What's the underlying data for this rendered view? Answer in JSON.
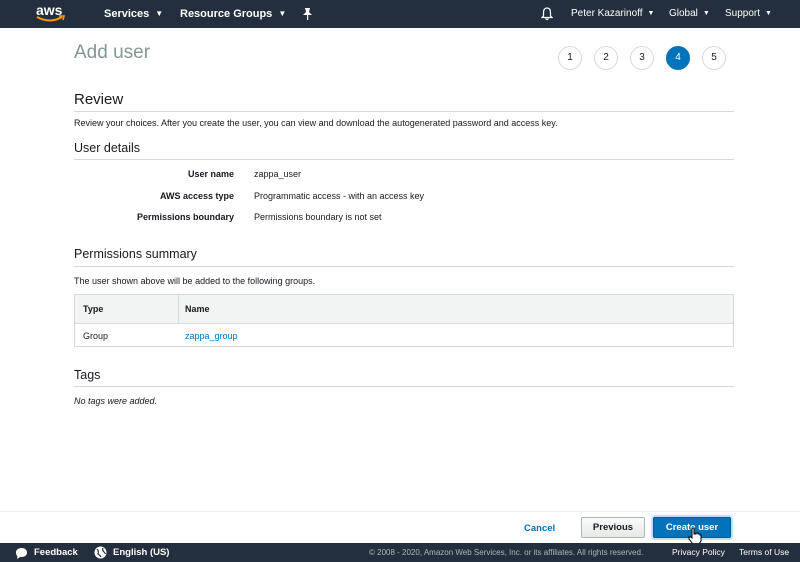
{
  "topnav": {
    "logo": "aws",
    "services": "Services",
    "resource_groups": "Resource Groups",
    "user": "Peter Kazarinoff",
    "region": "Global",
    "support": "Support"
  },
  "page": {
    "title": "Add user",
    "steps": [
      "1",
      "2",
      "3",
      "4",
      "5"
    ],
    "active_step": "4"
  },
  "review": {
    "heading": "Review",
    "description": "Review your choices. After you create the user, you can view and download the autogenerated password and access key."
  },
  "user_details": {
    "heading": "User details",
    "rows": [
      {
        "label": "User name",
        "value": "zappa_user"
      },
      {
        "label": "AWS access type",
        "value": "Programmatic access - with an access key"
      },
      {
        "label": "Permissions boundary",
        "value": "Permissions boundary is not set"
      }
    ]
  },
  "permissions": {
    "heading": "Permissions summary",
    "description": "The user shown above will be added to the following groups.",
    "columns": [
      "Type",
      "Name"
    ],
    "rows": [
      {
        "type": "Group",
        "name": "zappa_group"
      }
    ]
  },
  "tags": {
    "heading": "Tags",
    "empty": "No tags were added."
  },
  "actions": {
    "cancel": "Cancel",
    "previous": "Previous",
    "create": "Create user"
  },
  "footer": {
    "feedback": "Feedback",
    "language": "English (US)",
    "copyright": "© 2008 - 2020, Amazon Web Services, Inc. or its affiliates. All rights reserved.",
    "privacy": "Privacy Policy",
    "terms": "Terms of Use"
  },
  "colors": {
    "nav_bg": "#232f3e",
    "accent": "#0073bb",
    "title_gray": "#879596"
  }
}
